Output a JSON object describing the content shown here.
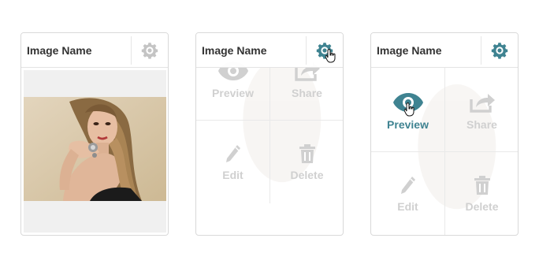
{
  "colors": {
    "accent": "#3f8391",
    "gear_inactive": "#c4c4c4",
    "action_inactive": "#d0d0d0",
    "border": "#d9d9d9"
  },
  "cards": [
    {
      "title": "Image Name",
      "gear_icon": "gear-icon",
      "state": "default",
      "content": "image-thumbnail"
    },
    {
      "title": "Image Name",
      "gear_icon": "gear-icon",
      "state": "gear-hover",
      "actions": [
        {
          "label": "Preview",
          "icon": "eye-icon"
        },
        {
          "label": "Share",
          "icon": "share-icon"
        },
        {
          "label": "Edit",
          "icon": "pencil-icon"
        },
        {
          "label": "Delete",
          "icon": "trash-icon"
        }
      ]
    },
    {
      "title": "Image Name",
      "gear_icon": "gear-icon",
      "state": "menu-open",
      "active_action": "Preview",
      "actions": [
        {
          "label": "Preview",
          "icon": "eye-icon"
        },
        {
          "label": "Share",
          "icon": "share-icon"
        },
        {
          "label": "Edit",
          "icon": "pencil-icon"
        },
        {
          "label": "Delete",
          "icon": "trash-icon"
        }
      ]
    }
  ]
}
